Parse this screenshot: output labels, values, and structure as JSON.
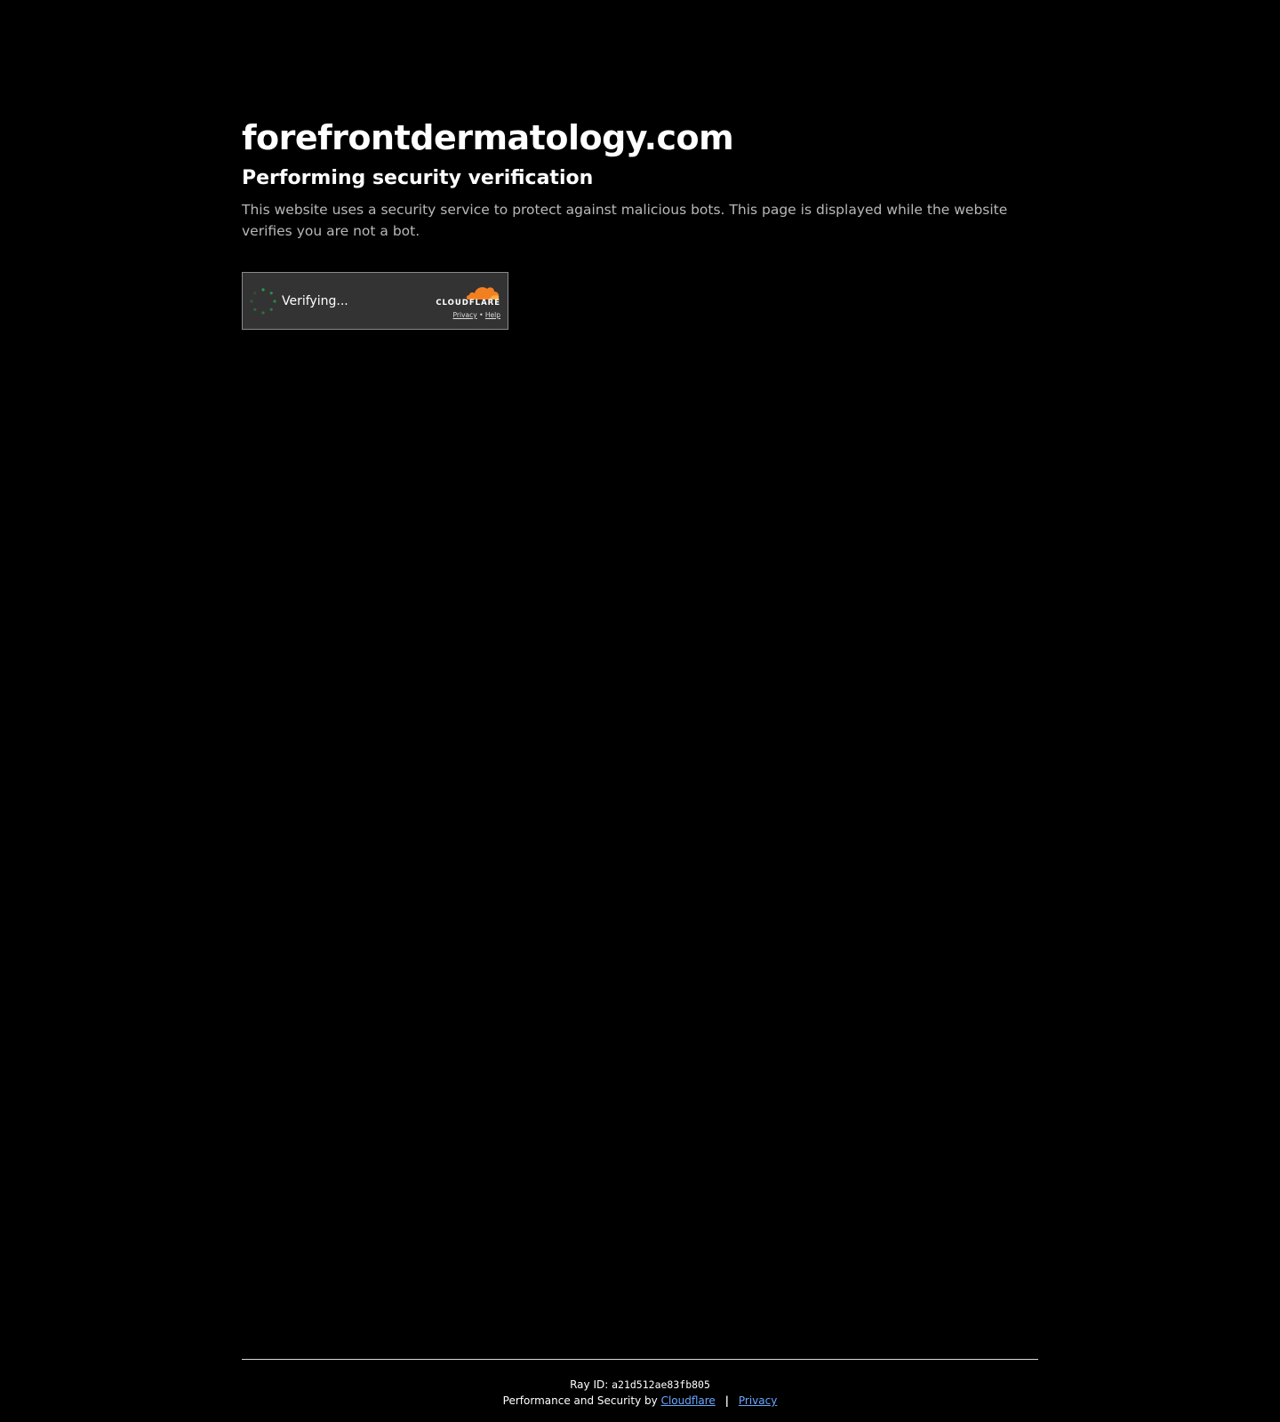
{
  "header": {
    "site_title": "forefrontdermatology.com",
    "subtitle": "Performing security verification",
    "description": "This website uses a security service to protect against malicious bots. This page is displayed while the website verifies you are not a bot."
  },
  "widget": {
    "status_text": "Verifying...",
    "brand_name": "CLOUDFLARE",
    "privacy_link": "Privacy",
    "link_separator": "•",
    "help_link": "Help",
    "spinner_color": "#2aa050",
    "brand_color": "#f38020"
  },
  "footer": {
    "ray_label": "Ray ID:",
    "ray_id": "a21d512ae83fb805",
    "performance_prefix": "Performance and Security by",
    "cloudflare_link": "Cloudflare",
    "separator": "|",
    "privacy_link": "Privacy",
    "link_color": "#6aa8ff"
  },
  "icons": {
    "spinner": "loading-spinner-icon",
    "logo": "cloudflare-cloud-icon"
  }
}
